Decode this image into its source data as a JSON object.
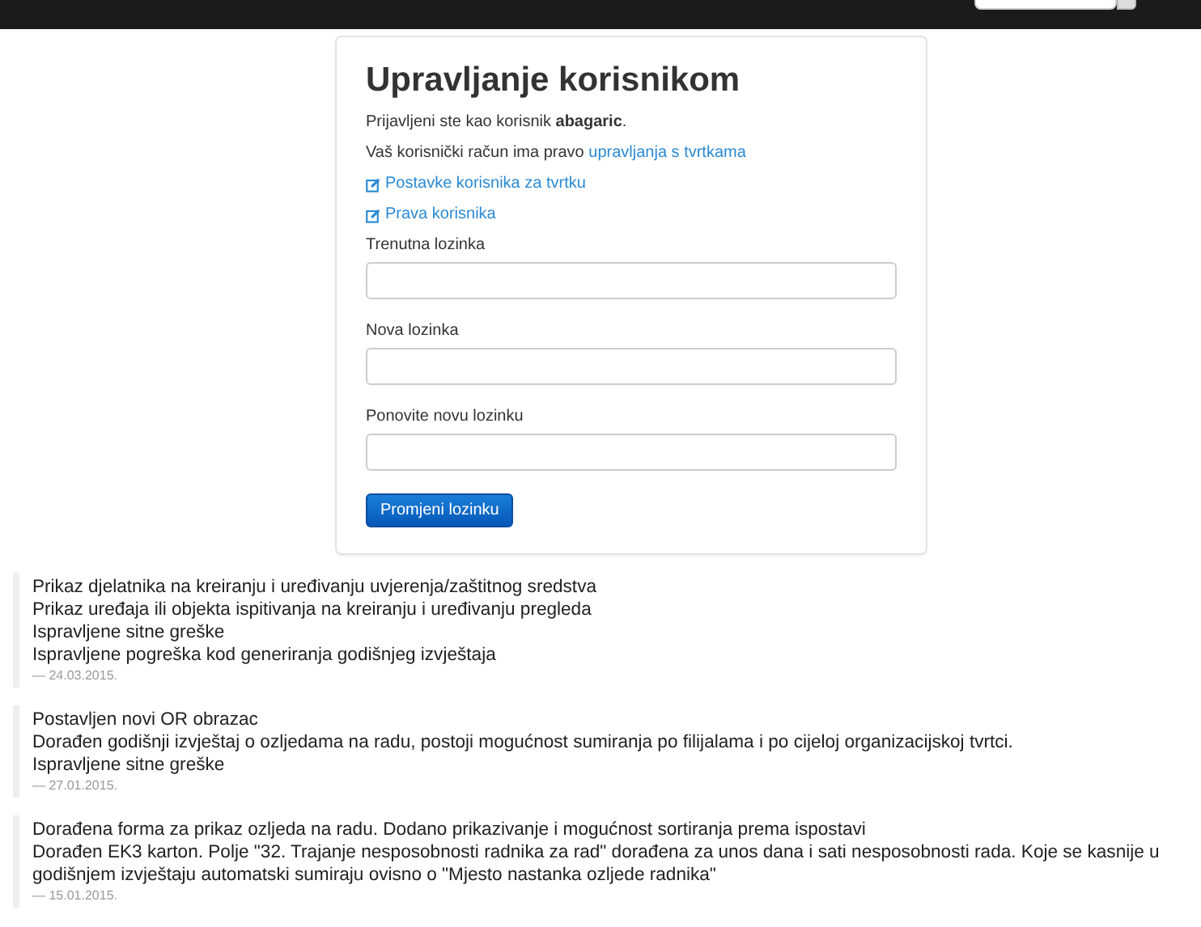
{
  "card": {
    "title": "Upravljanje korisnikom",
    "login_text": "Prijavljeni ste kao korisnik **abagaric**.",
    "rights_text": "Vaš korisnički račun ima pravo",
    "rights_link": "upravljanja s tvrtkama",
    "links": [
      "Postavke korisnika za tvrtku",
      "Prava korisnika"
    ],
    "fields": [
      {
        "label": "Trenutna lozinka"
      },
      {
        "label": "Nova lozinka"
      },
      {
        "label": "Ponovite novu lozinku"
      }
    ],
    "submit": "Promjeni lozinku"
  },
  "changelog": [
    {
      "lines": [
        "Prikaz djelatnika na kreiranju i uređivanju uvjerenja/zaštitnog sredstva",
        "Prikaz uređaja ili objekta ispitivanja na kreiranju i uređivanju pregleda",
        "Ispravljene sitne greške",
        "Ispravljene pogreška kod generiranja godišnjeg izvještaja"
      ],
      "date": "— 24.03.2015."
    },
    {
      "lines": [
        "Postavljen novi OR obrazac",
        "Dorađen godišnji izvještaj o ozljedama na radu, postoji mogućnost sumiranja po filijalama i po cijeloj organizacijskoj tvrtci.",
        "Ispravljene sitne greške"
      ],
      "date": "— 27.01.2015."
    },
    {
      "lines": [
        "Dorađena forma za prikaz ozljeda na radu. Dodano prikazivanje i mogućnost sortiranja prema ispostavi",
        "Dorađen EK3 karton. Polje \"32. Trajanje nesposobnosti radnika za rad\" dorađena za unos dana i sati nesposobnosti rada. Koje se kasnije u godišnjem izvještaju automatski sumiraju ovisno o \"Mjesto nastanka ozljede radnika\""
      ],
      "date": "— 15.01.2015."
    }
  ]
}
